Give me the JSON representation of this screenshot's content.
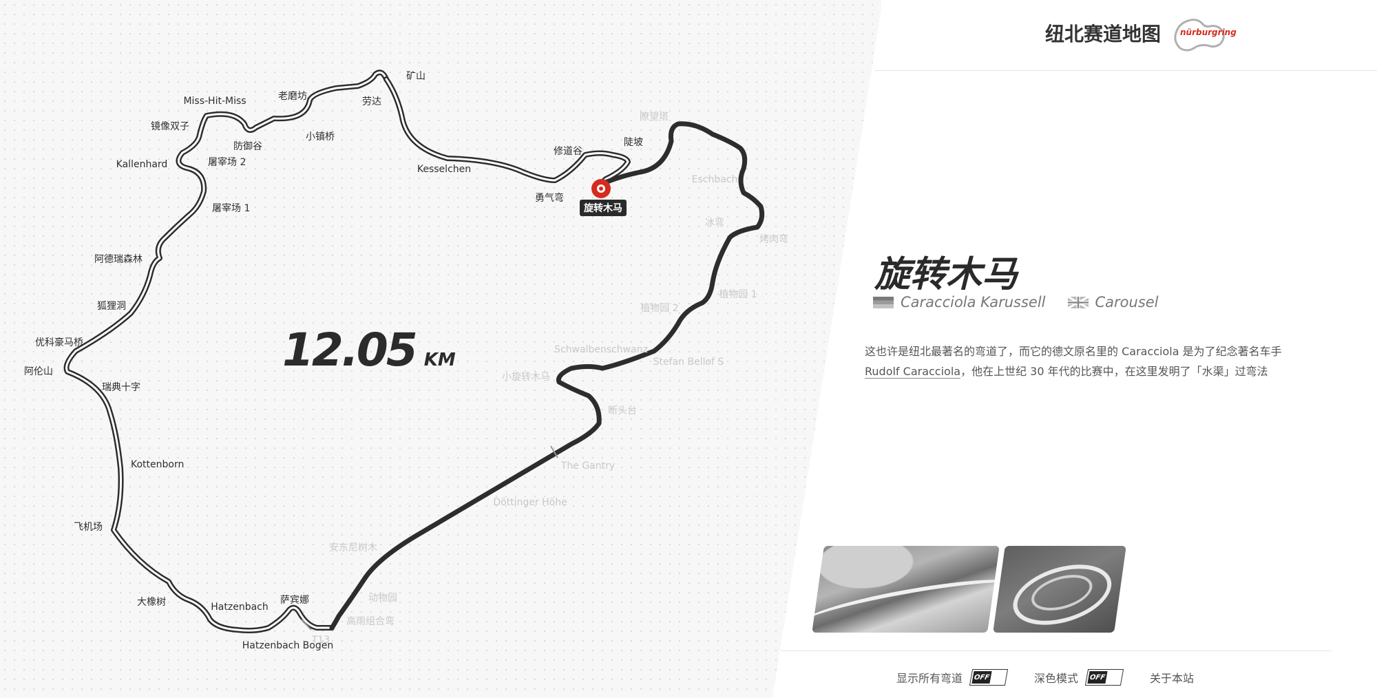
{
  "header": {
    "site_title": "纽北赛道地图",
    "logo_text": "nürburgring"
  },
  "map": {
    "distance_value": "12.05",
    "distance_unit": "KM",
    "selected_label": "旋转木马",
    "corner_labels": [
      "矿山",
      "劳达",
      "老磨坊",
      "Miss-Hit-Miss",
      "镜像双子",
      "防御谷",
      "小镇桥",
      "Kallenhard",
      "屠宰场 2",
      "屠宰场 1",
      "阿德瑞森林",
      "狐狸洞",
      "优科豪马桥",
      "阿伦山",
      "瑞典十字",
      "Kottenborn",
      "飞机场",
      "大橡树",
      "Hatzenbach",
      "萨宾娜",
      "Hatzenbach Bogen",
      "Kesselchen",
      "修道谷",
      "陡坡",
      "勇气弯"
    ],
    "faded_labels": [
      "瞭望塔",
      "Eschbach",
      "冰弯",
      "烤肉弯",
      "植物园 1",
      "植物园 2",
      "Schwalbenschwanz",
      "Stefan Bellof S",
      "小旋转木马",
      "断头台",
      "The Gantry",
      "Döttinger Höhe",
      "安东尼树木",
      "动物园",
      "高雨组合弯",
      "T13"
    ]
  },
  "corner": {
    "title": "旋转木马",
    "name_de": "Caracciola Karussell",
    "name_en": "Carousel",
    "description_part1": "这也许是纽北最著名的弯道了，而它的德文原名里的 Caracciola 是为了纪念著名车手",
    "description_link": "Rudolf Caracciola",
    "description_part2": "，他在上世纪 30 年代的比赛中，在这里发明了「水渠」过弯法"
  },
  "footer": {
    "show_all_label": "显示所有弯道",
    "show_all_state": "OFF",
    "dark_mode_label": "深色模式",
    "dark_mode_state": "OFF",
    "about_label": "关于本站"
  },
  "colors": {
    "track_dark": "#2d2d2d",
    "accent_red": "#d42b1e",
    "faded_text": "#c8c8c8"
  }
}
